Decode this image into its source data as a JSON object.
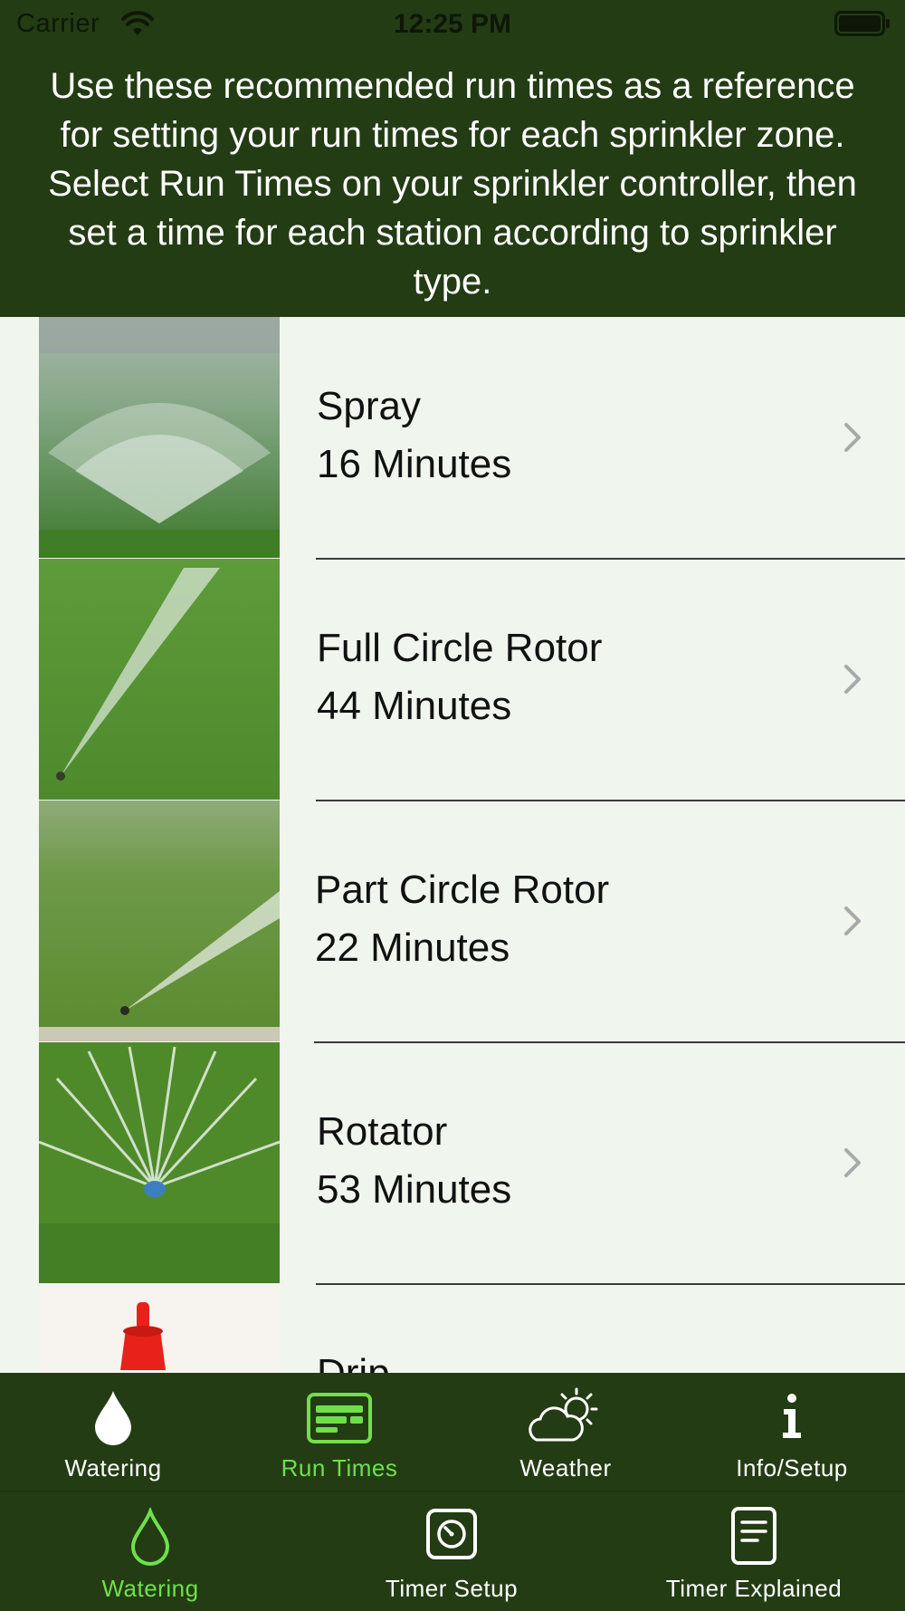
{
  "status_bar": {
    "carrier": "Carrier",
    "time": "12:25 PM"
  },
  "header": {
    "instructions": "Use these recommended run times as a reference for setting your run times for each sprinkler zone.  Select Run Times on your sprinkler controller, then set a time for each station according to sprinkler type."
  },
  "run_times": [
    {
      "name": "Spray",
      "time": "16 Minutes",
      "icon": "spray-sprinkler-photo"
    },
    {
      "name": "Full Circle Rotor",
      "time": "44 Minutes",
      "icon": "full-circle-rotor-photo"
    },
    {
      "name": "Part Circle Rotor",
      "time": "22 Minutes",
      "icon": "part-circle-rotor-photo"
    },
    {
      "name": "Rotator",
      "time": "53 Minutes",
      "icon": "rotator-photo"
    },
    {
      "name": "Drip",
      "time": "",
      "icon": "drip-emitter-photo"
    }
  ],
  "top_tabs": [
    {
      "label": "Watering",
      "icon": "water-drop-icon",
      "active": false
    },
    {
      "label": "Run Times",
      "icon": "run-times-icon",
      "active": true
    },
    {
      "label": "Weather",
      "icon": "weather-icon",
      "active": false
    },
    {
      "label": "Info/Setup",
      "icon": "info-icon",
      "active": false
    }
  ],
  "bottom_tabs": [
    {
      "label": "Watering",
      "icon": "water-drop-outline-icon",
      "active": true
    },
    {
      "label": "Timer Setup",
      "icon": "timer-setup-icon",
      "active": false
    },
    {
      "label": "Timer Explained",
      "icon": "document-icon",
      "active": false
    }
  ],
  "colors": {
    "header_bg": "#233c14",
    "list_bg": "#f0f5ee",
    "active_tab": "#6fe04a",
    "inactive_tab": "#ffffff"
  }
}
